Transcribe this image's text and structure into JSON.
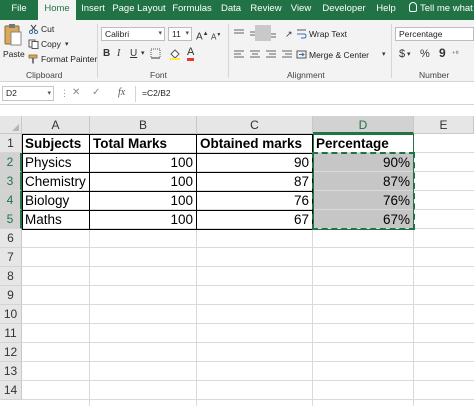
{
  "tabs": [
    "File",
    "Home",
    "Insert",
    "Page Layout",
    "Formulas",
    "Data",
    "Review",
    "View",
    "Developer",
    "Help"
  ],
  "active_tab": "Home",
  "tell_me": "Tell me what y",
  "ribbon": {
    "clipboard": {
      "paste": "Paste",
      "cut": "Cut",
      "copy": "Copy",
      "format_painter": "Format Painter",
      "label": "Clipboard"
    },
    "font": {
      "name": "Calibri",
      "size": "11",
      "bold": "B",
      "italic": "I",
      "underline": "U",
      "grow": "A",
      "shrink": "A",
      "label": "Font"
    },
    "alignment": {
      "wrap_text": "Wrap Text",
      "merge_center": "Merge & Center",
      "label": "Alignment"
    },
    "number": {
      "format": "Percentage",
      "currency": "$",
      "percent": "%",
      "comma": "9",
      "label": "Number"
    }
  },
  "formula_bar": {
    "name_box": "D2",
    "fx": "fx",
    "formula": "=C2/B2"
  },
  "columns": [
    "A",
    "B",
    "C",
    "D",
    "E"
  ],
  "selected_column": "D",
  "rows": [
    "1",
    "2",
    "3",
    "4",
    "5",
    "6",
    "7",
    "8",
    "9",
    "10",
    "11",
    "12",
    "13",
    "14"
  ],
  "table": {
    "headers": [
      "Subjects",
      "Total Marks",
      "Obtained marks",
      "Percentage"
    ],
    "rows": [
      [
        "Physics",
        "100",
        "90",
        "90%"
      ],
      [
        "Chemistry",
        "100",
        "87",
        "87%"
      ],
      [
        "Biology",
        "100",
        "76",
        "76%"
      ],
      [
        "Maths",
        "100",
        "67",
        "67%"
      ]
    ]
  },
  "colors": {
    "accent": "#217346",
    "selection_fill": "#c6c6c6"
  }
}
